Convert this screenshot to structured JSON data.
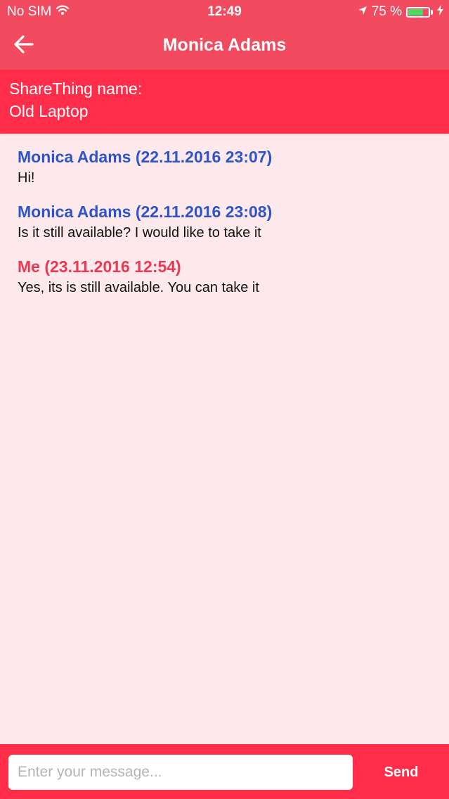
{
  "status_bar": {
    "carrier": "No SIM",
    "time": "12:49",
    "battery_text": "75 %",
    "battery_level": 0.75,
    "icons": [
      "wifi-icon",
      "location-arrow-icon",
      "battery-icon",
      "charging-bolt-icon"
    ]
  },
  "nav": {
    "back_icon": "arrow-left-icon",
    "title": "Monica Adams"
  },
  "thing": {
    "label": "ShareThing name:",
    "value": "Old Laptop"
  },
  "messages": [
    {
      "header": "Monica Adams (22.11.2016 23:07)",
      "text": "Hi!",
      "from": "other"
    },
    {
      "header": "Monica Adams (22.11.2016 23:08)",
      "text": "Is it still available? I would like to take it",
      "from": "other"
    },
    {
      "header": "Me (23.11.2016 12:54)",
      "text": "Yes, its is still available. You can take it",
      "from": "me"
    }
  ],
  "composer": {
    "placeholder": "Enter your message...",
    "value": "",
    "send_label": "Send"
  },
  "colors": {
    "bar": "#f24a5e",
    "header": "#ff2d49",
    "background": "#fde8ec",
    "other_name": "#2d55c8",
    "me_name": "#e83a52",
    "battery": "#4cd964"
  }
}
